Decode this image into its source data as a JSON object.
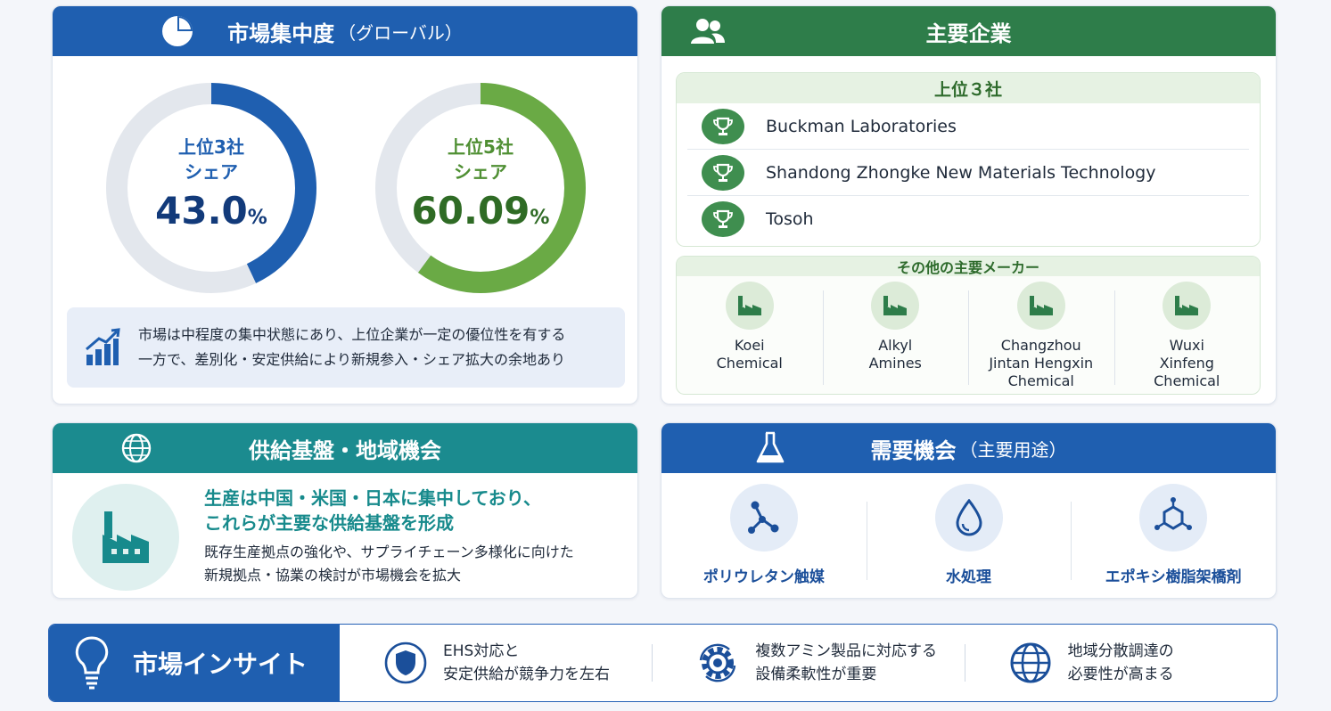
{
  "concentration": {
    "title": "市場集中度",
    "title_sub": "（グローバル）",
    "top3": {
      "label1": "上位3社",
      "label2": "シェア",
      "value": "43.0",
      "unit": "%",
      "share": 43.0,
      "color": "#1f5fb0"
    },
    "top5": {
      "label1": "上位5社",
      "label2": "シェア",
      "value": "60.09",
      "unit": "%",
      "share": 60.09,
      "color": "#6aaa45"
    },
    "note_line1": "市場は中程度の集中状態にあり、上位企業が一定の優位性を有する",
    "note_line2": "一方で、差別化・安定供給により新規参入・シェア拡大の余地あり"
  },
  "companies": {
    "title": "主要企業",
    "top3_title": "上位３社",
    "top3": [
      "Buckman Laboratories",
      "Shandong Zhongke New Materials Technology",
      "Tosoh"
    ],
    "others_title": "その他の主要メーカー",
    "others": [
      "Koei\nChemical",
      "Alkyl\nAmines",
      "Changzhou\nJintan Hengxin\nChemical",
      "Wuxi\nXinfeng\nChemical"
    ]
  },
  "supply": {
    "title": "供給基盤・地域機会",
    "headline1": "生産は中国・米国・日本に集中しており、",
    "headline2": "これらが主要な供給基盤を形成",
    "text1": "既存生産拠点の強化や、サプライチェーン多様化に向けた",
    "text2": "新規拠点・協業の検討が市場機会を拡大"
  },
  "demand": {
    "title": "需要機会",
    "title_sub": "（主要用途）",
    "items": [
      "ポリウレタン触媒",
      "水処理",
      "エポキシ樹脂架橋剤"
    ]
  },
  "insight": {
    "title": "市場インサイト",
    "items": [
      "EHS対応と\n安定供給が競争力を左右",
      "複数アミン製品に対応する\n設備柔軟性が重要",
      "地域分散調達の\n必要性が高まる"
    ]
  },
  "colors": {
    "blue": "#1f5fb0",
    "green": "#2e7d4a",
    "teal": "#1b8b8f",
    "track": "#e3e7ed"
  }
}
